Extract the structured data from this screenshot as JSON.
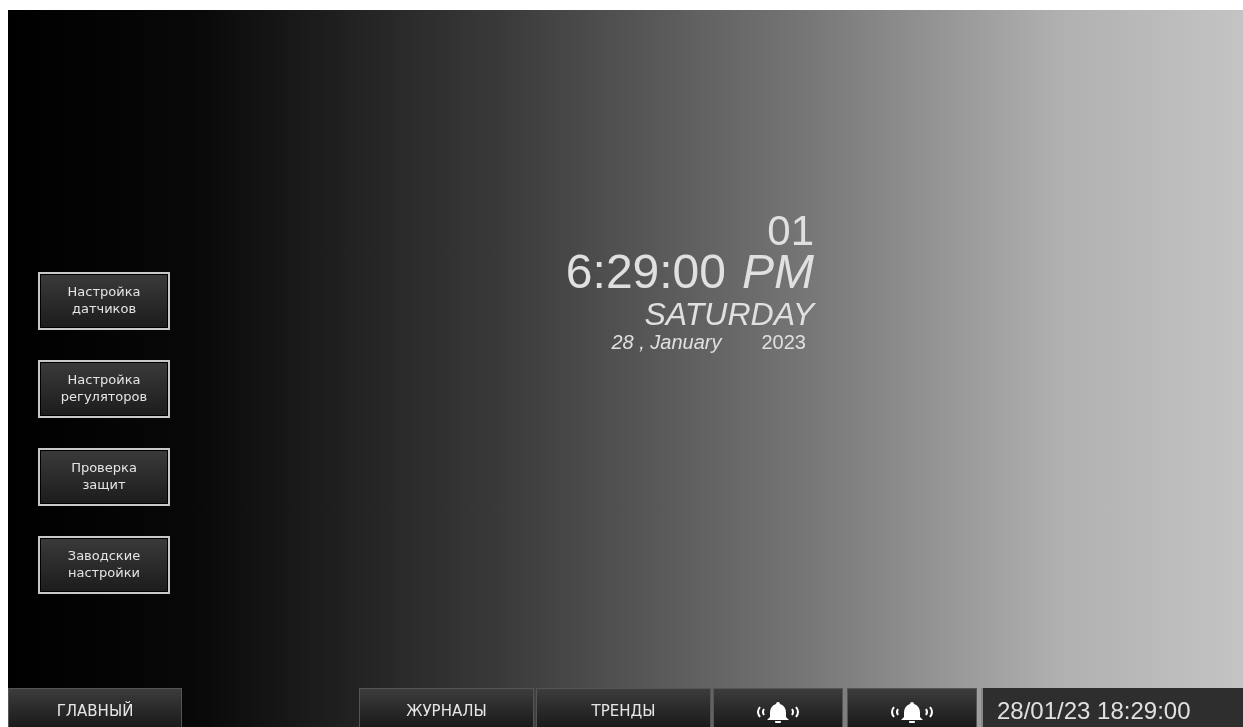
{
  "menu_buttons": [
    {
      "line1": "Настройка",
      "line2": "датчиков"
    },
    {
      "line1": "Настройка",
      "line2": "регуляторов"
    },
    {
      "line1": "Проверка",
      "line2": "защит"
    },
    {
      "line1": "Заводские",
      "line2": "настройки"
    }
  ],
  "clock": {
    "number": "01",
    "time": "6:29:00",
    "ampm": "PM",
    "weekday": "SATURDAY",
    "date": "28 , January",
    "year": "2023"
  },
  "bottom_bar": {
    "buttons": [
      {
        "kind": "text",
        "label": "ГЛАВНЫЙ"
      },
      {
        "kind": "text",
        "label": "ЖУРНАЛЫ"
      },
      {
        "kind": "text",
        "label": "ТРЕНДЫ"
      },
      {
        "kind": "bell"
      },
      {
        "kind": "bell"
      }
    ],
    "datetime": "28/01/23 18:29:00"
  }
}
